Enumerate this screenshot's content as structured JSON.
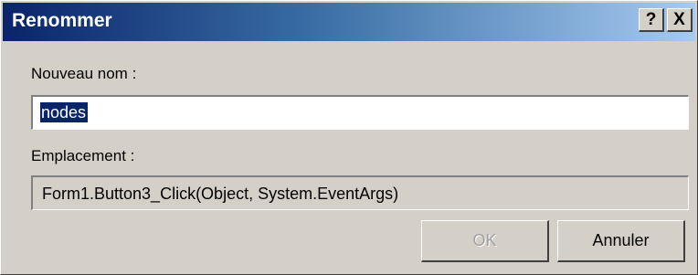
{
  "dialog": {
    "title": "Renommer",
    "help_glyph": "?",
    "close_glyph": "X"
  },
  "new_name": {
    "label": "Nouveau nom :",
    "value": "nodes"
  },
  "location": {
    "label": "Emplacement :",
    "value": "Form1.Button3_Click(Object, System.EventArgs)"
  },
  "buttons": {
    "ok": "OK",
    "cancel": "Annuler"
  },
  "colors": {
    "title_bar_start": "#0a246a",
    "title_bar_end": "#a6caf0",
    "face": "#d4d0c8",
    "selection": "#0a246a"
  }
}
